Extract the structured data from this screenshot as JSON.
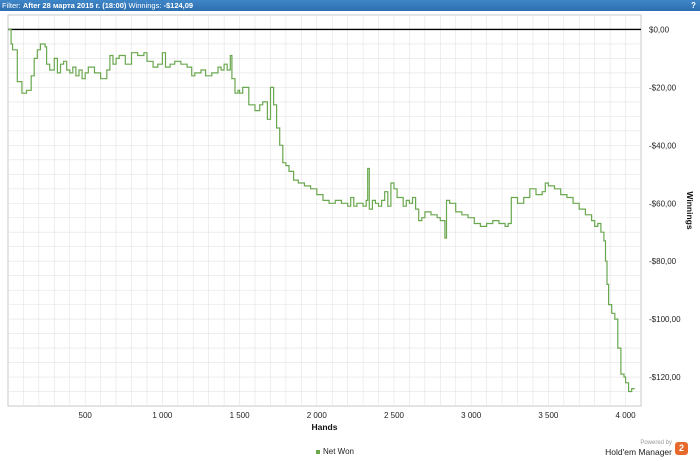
{
  "header": {
    "filter_label": "Filter:",
    "filter_value": "After 28 марта 2015 г. (18:00)",
    "winnings_label": "Winnings:",
    "winnings_value": "-$124,09",
    "help_icon": "help-icon"
  },
  "legend": {
    "label": "Net Won"
  },
  "footer": {
    "powered_by": "Powered by",
    "product": "Hold'em Manager",
    "logo_text": "2"
  },
  "colors": {
    "line": "#6aa84f",
    "zero_line": "#000000",
    "grid": "#e3e3e3",
    "header": "#3a7fc1"
  },
  "chart_data": {
    "type": "line",
    "xlabel": "Hands",
    "ylabel": "Winnings",
    "xlim": [
      0,
      4100
    ],
    "ylim": [
      -130,
      5
    ],
    "x_ticks": [
      500,
      1000,
      1500,
      2000,
      2500,
      3000,
      3500,
      4000
    ],
    "x_tick_labels": [
      "500",
      "1 000",
      "1 500",
      "2 000",
      "2 500",
      "3 000",
      "3 500",
      "4 000"
    ],
    "y_ticks": [
      0,
      -20,
      -40,
      -60,
      -80,
      -100,
      -120
    ],
    "y_tick_labels": [
      "$0,00",
      "-$20,00",
      "-$40,00",
      "-$60,00",
      "-$80,00",
      "-$100,00",
      "-$120,00"
    ],
    "grid": true,
    "legend_position": "bottom",
    "series": [
      {
        "name": "Net Won",
        "x": [
          0,
          20,
          30,
          60,
          90,
          120,
          150,
          170,
          190,
          210,
          240,
          250,
          270,
          300,
          320,
          340,
          360,
          380,
          400,
          420,
          440,
          460,
          480,
          500,
          520,
          560,
          600,
          640,
          660,
          680,
          700,
          720,
          760,
          800,
          840,
          880,
          900,
          940,
          970,
          1000,
          1020,
          1050,
          1080,
          1120,
          1160,
          1190,
          1210,
          1250,
          1280,
          1320,
          1360,
          1380,
          1400,
          1420,
          1440,
          1450,
          1470,
          1490,
          1500,
          1520,
          1540,
          1560,
          1580,
          1600,
          1630,
          1650,
          1680,
          1700,
          1720,
          1740,
          1760,
          1780,
          1800,
          1820,
          1850,
          1880,
          1920,
          1960,
          2000,
          2040,
          2080,
          2120,
          2160,
          2200,
          2220,
          2240,
          2260,
          2280,
          2300,
          2320,
          2330,
          2340,
          2360,
          2380,
          2400,
          2420,
          2440,
          2460,
          2480,
          2500,
          2520,
          2540,
          2560,
          2580,
          2600,
          2620,
          2640,
          2660,
          2680,
          2700,
          2740,
          2780,
          2800,
          2820,
          2830,
          2840,
          2860,
          2900,
          2940,
          2980,
          3020,
          3060,
          3100,
          3140,
          3180,
          3220,
          3240,
          3260,
          3300,
          3340,
          3380,
          3420,
          3460,
          3480,
          3500,
          3540,
          3580,
          3620,
          3660,
          3700,
          3740,
          3780,
          3800,
          3820,
          3840,
          3860,
          3870,
          3880,
          3890,
          3900,
          3910,
          3930,
          3950,
          3970,
          3990,
          4000,
          4020,
          4040,
          4060
        ],
        "values": [
          0,
          -5,
          -7,
          -18,
          -22,
          -21,
          -16,
          -10,
          -7,
          -5,
          -6,
          -12,
          -14,
          -10,
          -15,
          -12,
          -11,
          -14,
          -15,
          -13,
          -16,
          -14,
          -17,
          -15,
          -13,
          -15,
          -17,
          -14,
          -9,
          -12,
          -10,
          -9,
          -12,
          -8,
          -9,
          -8,
          -11,
          -13,
          -12,
          -8,
          -13,
          -12,
          -11,
          -12,
          -13,
          -16,
          -15,
          -14,
          -16,
          -15,
          -13,
          -14,
          -12,
          -14,
          -9,
          -17,
          -22,
          -21,
          -22,
          -20,
          -20,
          -26,
          -26,
          -28,
          -26,
          -25,
          -31,
          -20,
          -26,
          -34,
          -40,
          -46,
          -47,
          -49,
          -52,
          -53,
          -54,
          -55,
          -57,
          -59,
          -60,
          -59,
          -60,
          -61,
          -58,
          -61,
          -60,
          -60,
          -61,
          -59,
          -48,
          -62,
          -59,
          -60,
          -61,
          -59,
          -56,
          -61,
          -53,
          -55,
          -58,
          -58,
          -61,
          -59,
          -60,
          -58,
          -62,
          -66,
          -65,
          -63,
          -64,
          -65,
          -66,
          -66,
          -72,
          -59,
          -60,
          -63,
          -64,
          -65,
          -67,
          -68,
          -67,
          -66,
          -67,
          -68,
          -67,
          -58,
          -60,
          -58,
          -55,
          -57,
          -56,
          -53,
          -54,
          -55,
          -57,
          -58,
          -60,
          -62,
          -64,
          -66,
          -68,
          -67,
          -70,
          -73,
          -80,
          -88,
          -95,
          -95,
          -98,
          -100,
          -110,
          -119,
          -120,
          -122,
          -125,
          -124,
          -124
        ]
      }
    ]
  }
}
